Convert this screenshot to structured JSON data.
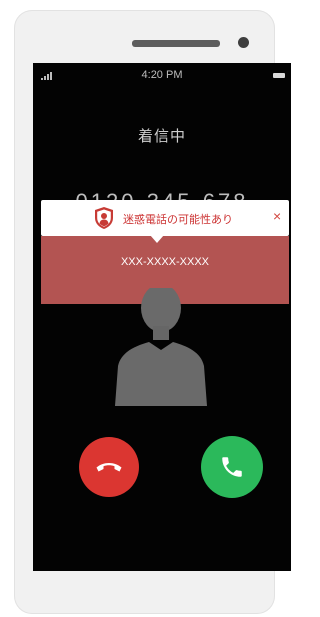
{
  "status_bar": {
    "time": "4:20 PM",
    "signal_icon": "signal-icon",
    "battery_icon": "battery-icon"
  },
  "call": {
    "status": "着信中",
    "number": "0120-345-678"
  },
  "spam_alert": {
    "icon": "shield-icon",
    "message": "迷惑電話の可能性あり",
    "close_label": "×",
    "masked_number": "XXX-XXXX-XXXX"
  },
  "actions": {
    "decline_icon": "phone-hangup-icon",
    "accept_icon": "phone-icon"
  },
  "colors": {
    "alert_text": "#cc3333",
    "alert_band": "#b35452",
    "decline": "#db3631",
    "accept": "#2bb95b"
  }
}
